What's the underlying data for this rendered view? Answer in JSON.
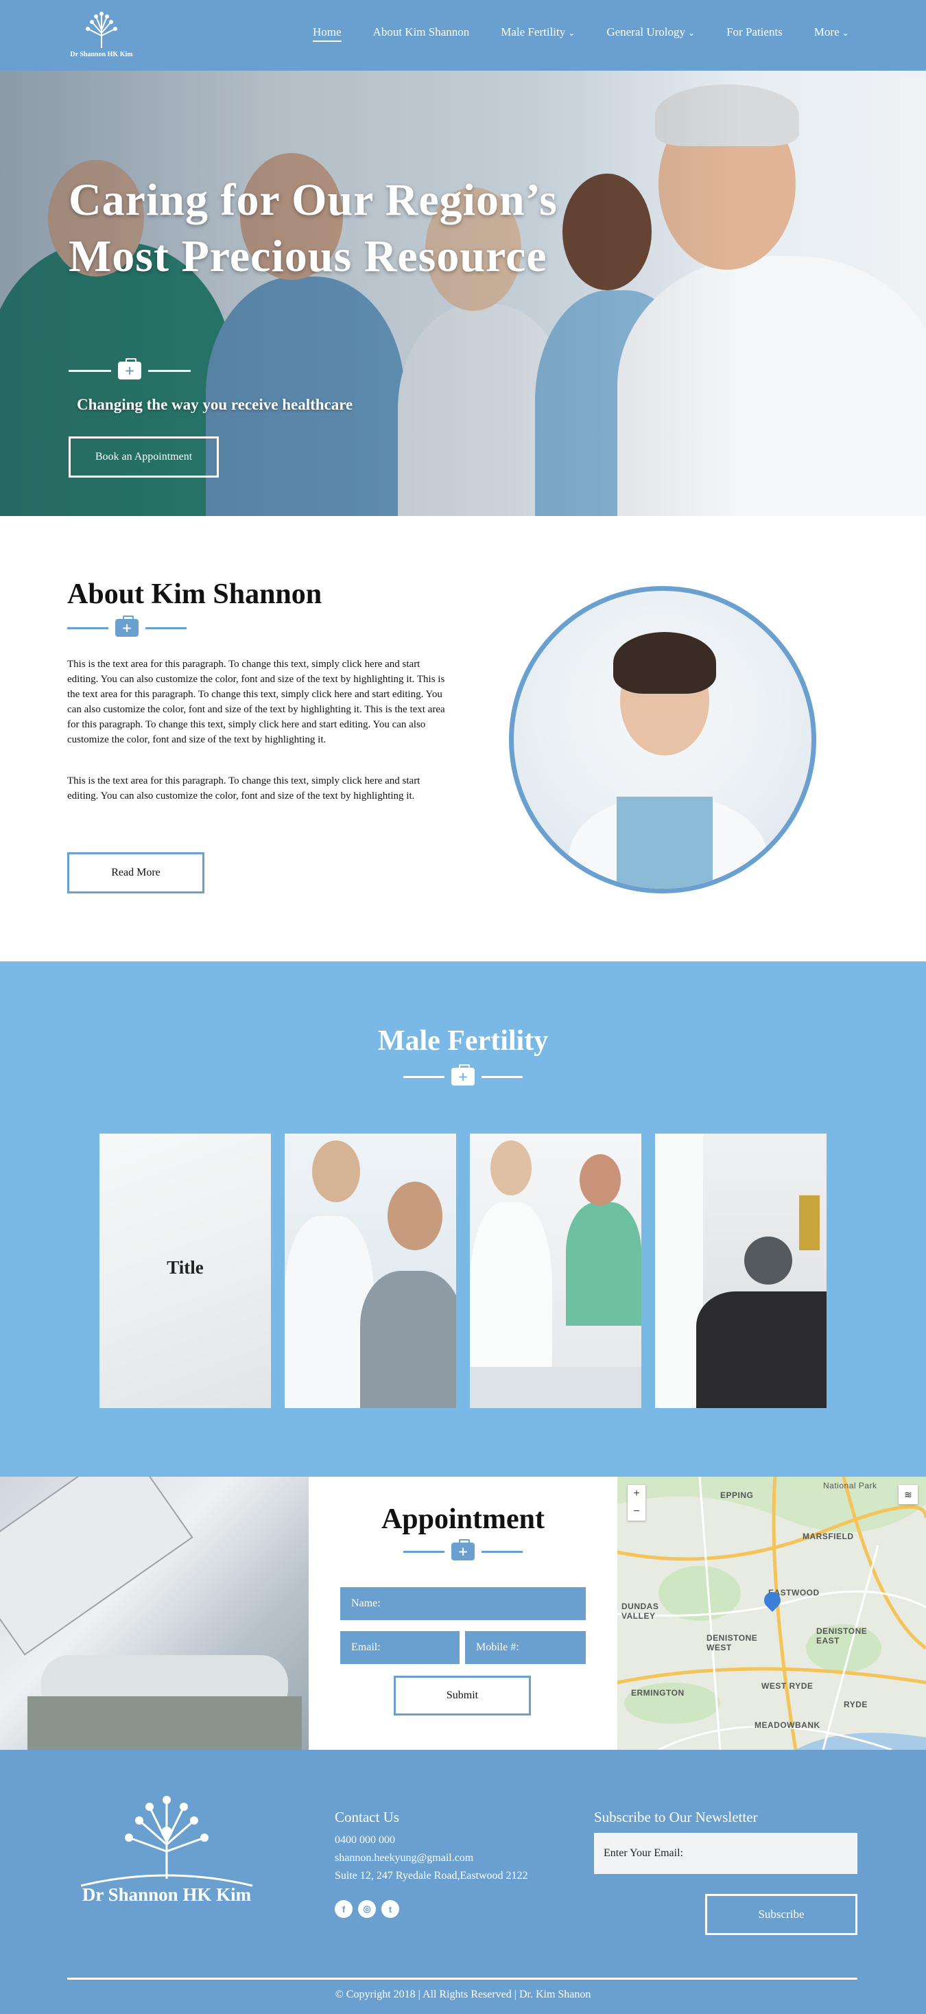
{
  "nav": {
    "logo_text": "Dr Shannon HK Kim",
    "items": [
      {
        "label": "Home",
        "chevron": false
      },
      {
        "label": "About Kim Shannon",
        "chevron": false
      },
      {
        "label": "Male Fertility",
        "chevron": true
      },
      {
        "label": "General Urology",
        "chevron": true
      },
      {
        "label": "For Patients",
        "chevron": false
      },
      {
        "label": "More",
        "chevron": true
      }
    ]
  },
  "hero": {
    "title": "Caring for Our Region’s Most Precious Resource",
    "subtitle": "Changing the way you receive healthcare",
    "button": "Book an Appointment"
  },
  "about": {
    "title": "About Kim Shannon",
    "paragraph1": "This is the text area for this paragraph. To change this text, simply click here and start editing. You can also customize the color, font and size of the text by highlighting it. This is the text area for this paragraph. To change this text, simply click here and start editing. You can also customize the color, font and size of the text by highlighting it. This is the text area for this paragraph. To change this text, simply click here and start editing. You can also customize the color, font and size of the text by highlighting it.",
    "paragraph2": "This is the text area for this paragraph. To change this text, simply click here and start editing. You can also customize the color, font and size of the text by highlighting it.",
    "button": "Read More"
  },
  "fertility": {
    "title": "Male Fertility",
    "card_title": "Title"
  },
  "appointment": {
    "title": "Appointment",
    "name_placeholder": "Name:",
    "email_placeholder": "Email:",
    "mobile_placeholder": "Mobile #:",
    "submit": "Submit"
  },
  "map": {
    "zoom_in": "+",
    "zoom_out": "−",
    "labels": [
      {
        "text": "EPPING"
      },
      {
        "text": "MARSFIELD"
      },
      {
        "text": "EASTWOOD"
      },
      {
        "text": "DUNDAS VALLEY"
      },
      {
        "text": "DENISTONE WEST"
      },
      {
        "text": "DENISTONE EAST"
      },
      {
        "text": "WEST RYDE"
      },
      {
        "text": "ERMINGTON"
      },
      {
        "text": "RYDE"
      },
      {
        "text": "MEADOWBANK"
      },
      {
        "text": "National Park"
      }
    ]
  },
  "footer": {
    "logo_text": "Dr Shannon HK Kim",
    "contact_title": "Contact Us",
    "phone": "0400 000 000",
    "email": "shannon.heekyung@gmail.com",
    "address": "Suite 12, 247 Ryedale Road,Eastwood 2122",
    "social": [
      "f",
      "◎",
      "t"
    ],
    "newsletter_title": "Subscribe to Our Newsletter",
    "email_placeholder": "Enter Your Email:",
    "subscribe": "Subscribe",
    "copyright": "© Copyright 2018 | All Rights Reserved | Dr. Kim Shanon"
  },
  "colors": {
    "primary": "#6aa0cf",
    "section_blue": "#7ab8e6"
  }
}
